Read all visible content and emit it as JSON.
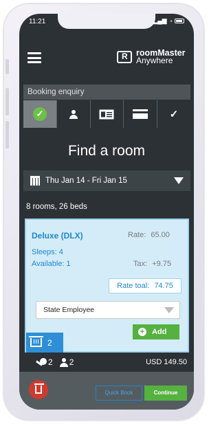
{
  "status": {
    "time": "11:21"
  },
  "header": {
    "brand_line1": "roomMaster",
    "brand_line2": "Anywhere"
  },
  "booking": {
    "label": "Booking enquiry"
  },
  "steps": [
    {
      "name": "availability",
      "icon": "check-circle-icon"
    },
    {
      "name": "guest",
      "icon": "person-icon"
    },
    {
      "name": "details",
      "icon": "id-card-icon"
    },
    {
      "name": "payment",
      "icon": "credit-card-icon"
    },
    {
      "name": "confirm",
      "icon": "checkmark-icon"
    }
  ],
  "page": {
    "title": "Find a room"
  },
  "date_range": {
    "label": "Thu Jan 14 - Fri Jan 15"
  },
  "rooms_summary": "8 rooms, 26 beds",
  "room": {
    "name": "Deluxe (DLX)",
    "rate_label": "Rate:",
    "rate_value": "65.00",
    "sleeps": "Sleeps: 4",
    "available": "Available: 1",
    "tax_label": "Tax:",
    "tax_value": "+9.75",
    "rate_total_label": "Rate toal:",
    "rate_total_value": "74.75",
    "rate_type": "State Employee",
    "add_label": "Add"
  },
  "basket": {
    "count": "2"
  },
  "summary": {
    "keys": "2",
    "guests": "2",
    "price": "USD 149.50"
  },
  "footer": {
    "quick_book": "Quick Book",
    "continue": "Continue"
  },
  "colors": {
    "accent_blue": "#1f86cf",
    "accent_green": "#55b140",
    "danger": "#cf3b2e",
    "background": "#2b3135"
  }
}
